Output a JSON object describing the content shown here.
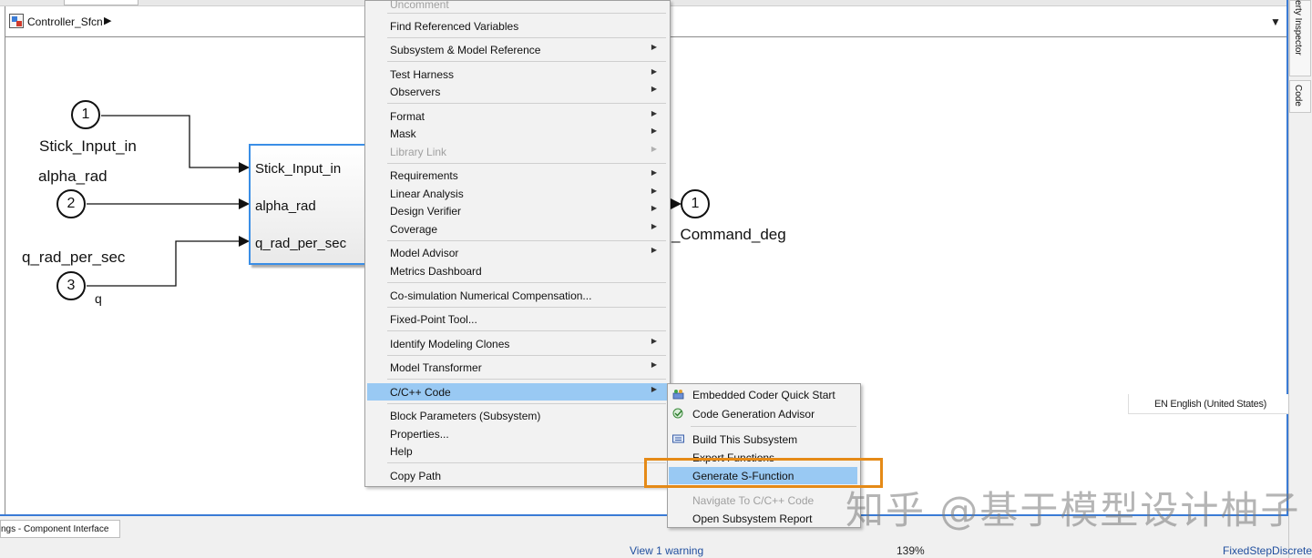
{
  "breadcrumb": {
    "model_name": "Controller_Sfcn"
  },
  "right_panel": {
    "tabs": [
      "Property Inspector",
      "Code"
    ]
  },
  "diagram": {
    "inports": [
      {
        "number": "1",
        "name": "Stick_Input_in"
      },
      {
        "number": "2",
        "name": "alpha_rad"
      },
      {
        "number": "3",
        "name": "q_rad_per_sec"
      }
    ],
    "signal_label_q": "q",
    "subsystem_ports": [
      "Stick_Input_in",
      "alpha_rad",
      "q_rad_per_sec"
    ],
    "outport": {
      "number": "1",
      "name": "_Command_deg"
    }
  },
  "context_menu": {
    "items": [
      {
        "label": "Uncomment",
        "disabled": true
      },
      {
        "label": "Find Referenced Variables"
      },
      {
        "label": "Subsystem & Model Reference",
        "submenu": true
      },
      {
        "label": "Test Harness",
        "submenu": true
      },
      {
        "label": "Observers",
        "submenu": true
      },
      {
        "label": "Format",
        "submenu": true
      },
      {
        "label": "Mask",
        "submenu": true
      },
      {
        "label": "Library Link",
        "submenu": true,
        "disabled": true
      },
      {
        "label": "Requirements",
        "submenu": true
      },
      {
        "label": "Linear Analysis",
        "submenu": true
      },
      {
        "label": "Design Verifier",
        "submenu": true
      },
      {
        "label": "Coverage",
        "submenu": true
      },
      {
        "label": "Model Advisor",
        "submenu": true
      },
      {
        "label": "Metrics Dashboard"
      },
      {
        "label": "Co-simulation Numerical Compensation..."
      },
      {
        "label": "Fixed-Point Tool..."
      },
      {
        "label": "Identify Modeling Clones",
        "submenu": true
      },
      {
        "label": "Model Transformer",
        "submenu": true
      },
      {
        "label": "C/C++ Code",
        "submenu": true,
        "highlighted": true
      },
      {
        "label": "Block Parameters (Subsystem)"
      },
      {
        "label": "Properties..."
      },
      {
        "label": "Help"
      },
      {
        "label": "Copy Path"
      }
    ]
  },
  "submenu": {
    "items": [
      {
        "label": "Embedded Coder Quick Start",
        "icon": "embedded-coder-quick-start-icon"
      },
      {
        "label": "Code Generation Advisor",
        "icon": "code-generation-advisor-icon"
      },
      {
        "label": "Build This Subsystem",
        "icon": "build-subsystem-icon"
      },
      {
        "label": "Export Functions"
      },
      {
        "label": "Generate S-Function",
        "highlighted": true
      },
      {
        "label": "Navigate To C/C++ Code",
        "disabled": true
      },
      {
        "label": "Open Subsystem Report"
      }
    ]
  },
  "language_indicator": "EN English (United States)",
  "status_bar": {
    "tab_label": "ngs - Component Interface",
    "warning_text": "View 1 warning",
    "zoom": "139%",
    "solver": "FixedStepDiscrete"
  },
  "watermark": "知乎 @基于模型设计柚子",
  "colors": {
    "selection": "#99c9f3",
    "accent": "#3a7bd5",
    "callout": "#e58a17"
  }
}
